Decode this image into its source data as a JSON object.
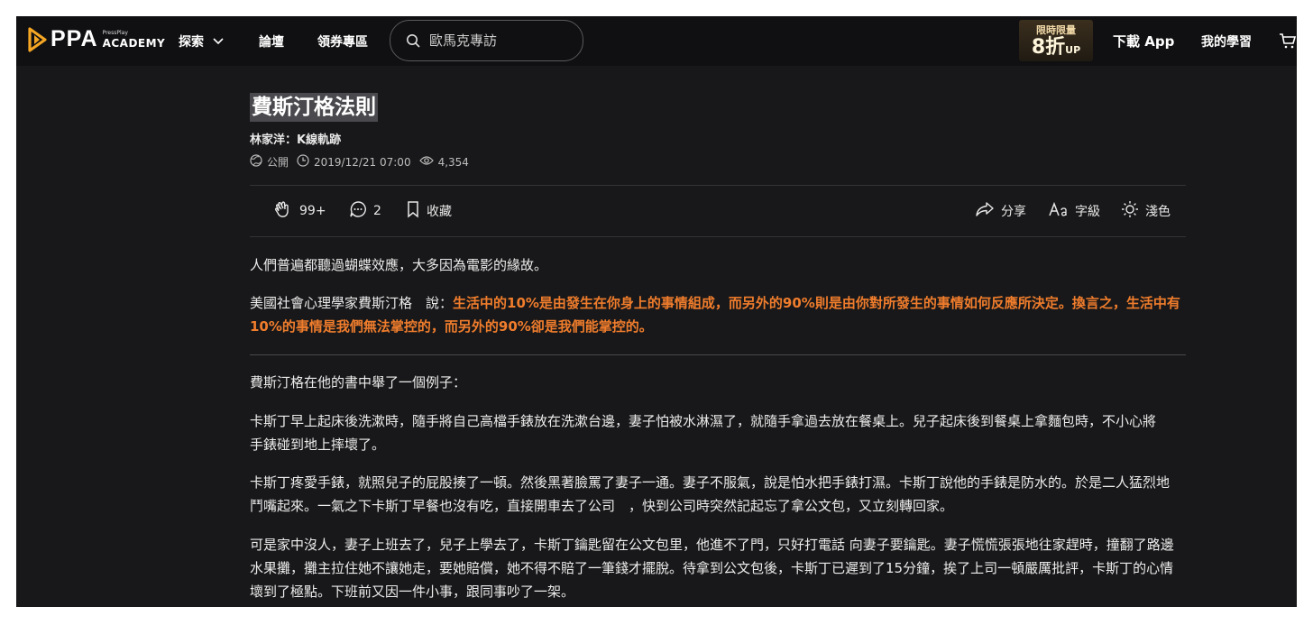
{
  "header": {
    "logo_text": "PPA",
    "logo_sub1": "PressPlay",
    "logo_sub2": "ACADEMY",
    "nav_explore": "探索",
    "nav_forum": "論壇",
    "nav_coupon": "領券專區",
    "search_placeholder": "歐馬克專訪",
    "promo_line1": "限時限量",
    "promo_line2": "8折",
    "promo_suffix": "UP",
    "download": "下載 App",
    "my_learning": "我的學習"
  },
  "article": {
    "title": "費斯汀格法則",
    "author": "林家洋：K線軌跡",
    "visibility": "公開",
    "datetime": "2019/12/21 07:00",
    "views": "4,354",
    "claps": "99+",
    "comments": "2",
    "save_label": "收藏",
    "share_label": "分享",
    "font_label": "字級",
    "theme_label": "淺色",
    "p1": "人們普遍都聽過蝴蝶效應，大多因為電影的緣故。",
    "p2_prefix": "美國社會心理學家費斯汀格　說：",
    "p2_highlight": "生活中的10%是由發生在你身上的事情組成，而另外的90%則是由你對所發生的事情如何反應所決定。換言之，生活中有10%的事情是我們無法掌控的，而另外的90%卻是我們能掌控的。",
    "p3": "費斯汀格在他的書中舉了一個例子：",
    "p4": "卡斯丁早上起床後洗漱時，隨手將自己高檔手錶放在洗漱台邊，妻子怕被水淋濕了，就隨手拿過去放在餐桌上。兒子起床後到餐桌上拿麵包時，不小心將手錶碰到地上摔壞了。",
    "p5": "卡斯丁疼愛手錶，就照兒子的屁股揍了一頓。然後黑著臉罵了妻子一通。妻子不服氣，說是怕水把手錶打濕。卡斯丁說他的手錶是防水的。於是二人猛烈地鬥嘴起來。一氣之下卡斯丁早餐也沒有吃，直接開車去了公司　，快到公司時突然記起忘了拿公文包，又立刻轉回家。",
    "p6": "可是家中沒人，妻子上班去了，兒子上學去了，卡斯丁鑰匙留在公文包里，他進不了門，只好打電話 向妻子要鑰匙。妻子慌慌張張地往家趕時，撞翻了路邊水果攤，攤主拉住她不讓她走，要她賠償，她不得不賠了一筆錢才擺脫。待拿到公文包後，卡斯丁已遲到了15分鐘，挨了上司一頓嚴厲批評，卡斯丁的心情壞到了極點。下班前又因一件小事，跟同事吵了一架。"
  },
  "colors": {
    "background": "#18181a",
    "header": "#101012",
    "accent_orange": "#f07d2c",
    "logo_orange": "#f5a623"
  },
  "icons": [
    "ppa-logo-icon",
    "chevron-down-icon",
    "search-icon",
    "cart-icon",
    "globe-icon",
    "clock-icon",
    "eye-icon",
    "clap-icon",
    "comment-icon",
    "bookmark-icon",
    "share-icon",
    "font-size-icon",
    "sun-icon"
  ]
}
